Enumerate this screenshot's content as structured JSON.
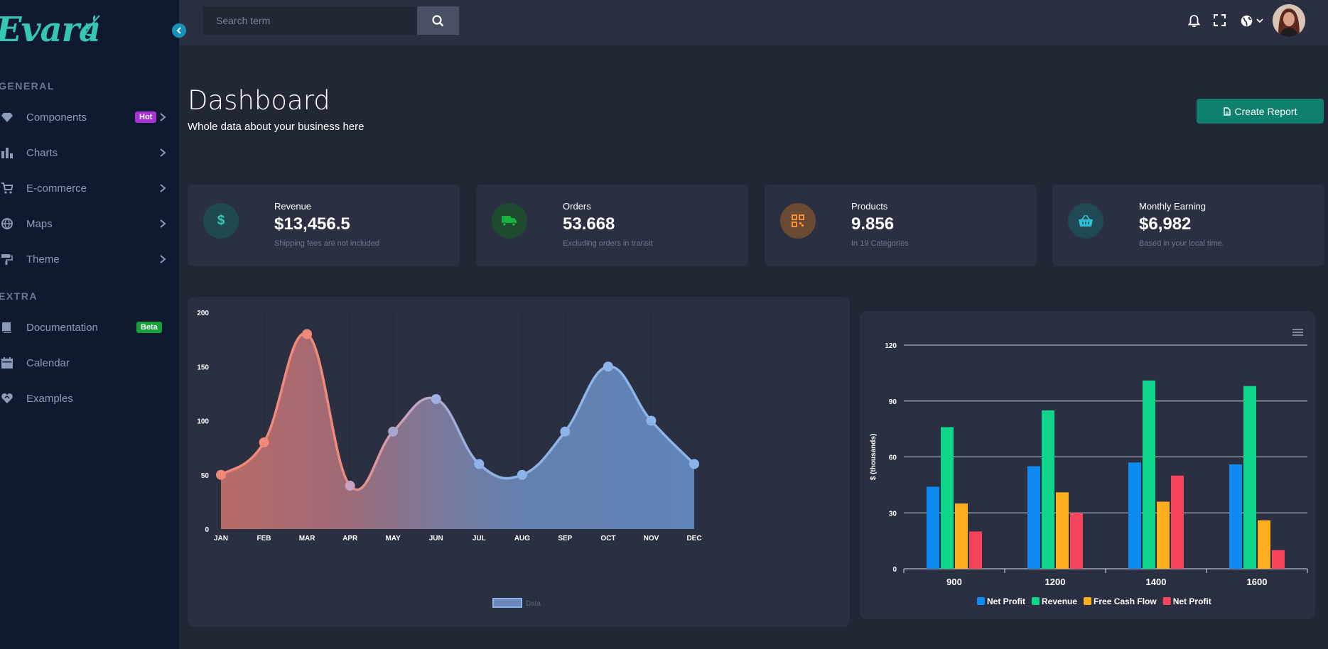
{
  "sidebar": {
    "logo": "Evara",
    "section_general": "GENERAL",
    "section_extra": "EXTRA",
    "items": [
      {
        "label": "Components",
        "badge": "Hot"
      },
      {
        "label": "Charts"
      },
      {
        "label": "E-commerce"
      },
      {
        "label": "Maps"
      },
      {
        "label": "Theme"
      },
      {
        "label": "Documentation",
        "badge": "Beta"
      },
      {
        "label": "Calendar"
      },
      {
        "label": "Examples"
      }
    ]
  },
  "topbar": {
    "search_placeholder": "Search term"
  },
  "header": {
    "title": "Dashboard",
    "subtitle": "Whole data about your business here",
    "create_report": "Create Report"
  },
  "stats": [
    {
      "label": "Revenue",
      "value": "$13,456.5",
      "note": "Shipping fees are not included",
      "icon": "dollar-icon",
      "color": "#36c6b6"
    },
    {
      "label": "Orders",
      "value": "53.668",
      "note": "Excluding orders in transit",
      "icon": "truck-icon",
      "color": "#19b23c"
    },
    {
      "label": "Products",
      "value": "9.856",
      "note": "In 19 Categories",
      "icon": "qrcode-icon",
      "color": "#f7903b"
    },
    {
      "label": "Monthly Earning",
      "value": "$6,982",
      "note": "Based in your local time.",
      "icon": "basket-icon",
      "color": "#2cc3d8"
    }
  ],
  "colors": {
    "accent": "#0f7f6e",
    "hot_badge": "#a933d6",
    "beta_badge": "#17a03a"
  },
  "chart_data": [
    {
      "type": "area",
      "categories": [
        "JAN",
        "FEB",
        "MAR",
        "APR",
        "MAY",
        "JUN",
        "JUL",
        "AUG",
        "SEP",
        "OCT",
        "NOV",
        "DEC"
      ],
      "series": [
        {
          "name": "Data",
          "values": [
            50,
            80,
            180,
            40,
            90,
            120,
            60,
            50,
            90,
            150,
            100,
            60
          ]
        }
      ],
      "ylim": [
        0,
        200
      ],
      "yticks": [
        0,
        50,
        100,
        150,
        200
      ],
      "legend": "bottom",
      "grid": "vertical"
    },
    {
      "type": "bar",
      "categories": [
        "900",
        "1200",
        "1400",
        "1600"
      ],
      "ylabel": "$ (thousands)",
      "ylim": [
        0,
        120
      ],
      "yticks": [
        0,
        30,
        60,
        90,
        120
      ],
      "series": [
        {
          "name": "Net Profit",
          "color": "#0d8bf2",
          "values": [
            44,
            55,
            57,
            56
          ]
        },
        {
          "name": "Revenue",
          "color": "#0ed58a",
          "values": [
            76,
            85,
            101,
            98
          ]
        },
        {
          "name": "Free Cash Flow",
          "color": "#ffae1f",
          "values": [
            35,
            41,
            36,
            26
          ]
        },
        {
          "name": "Net Profit",
          "color": "#f5445c",
          "values": [
            20,
            30,
            50,
            10
          ]
        }
      ],
      "legend": "bottom",
      "grid": "horizontal"
    }
  ]
}
